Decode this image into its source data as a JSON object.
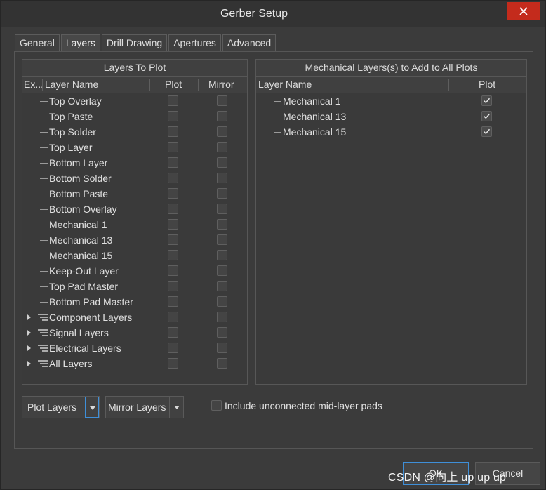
{
  "window": {
    "title": "Gerber Setup"
  },
  "tabs": [
    {
      "label": "General"
    },
    {
      "label": "Layers"
    },
    {
      "label": "Drill Drawing"
    },
    {
      "label": "Apertures"
    },
    {
      "label": "Advanced"
    }
  ],
  "layers_panel": {
    "title": "Layers To Plot",
    "col_expand": "Ex...",
    "col_name": "Layer Name",
    "col_plot": "Plot",
    "col_mirror": "Mirror",
    "rows": [
      {
        "name": "Top Overlay",
        "kind": "layer",
        "plot": false,
        "mirror": false
      },
      {
        "name": "Top Paste",
        "kind": "layer",
        "plot": false,
        "mirror": false
      },
      {
        "name": "Top Solder",
        "kind": "layer",
        "plot": false,
        "mirror": false
      },
      {
        "name": "Top Layer",
        "kind": "layer",
        "plot": false,
        "mirror": false
      },
      {
        "name": "Bottom Layer",
        "kind": "layer",
        "plot": false,
        "mirror": false
      },
      {
        "name": "Bottom Solder",
        "kind": "layer",
        "plot": false,
        "mirror": false
      },
      {
        "name": "Bottom Paste",
        "kind": "layer",
        "plot": false,
        "mirror": false
      },
      {
        "name": "Bottom Overlay",
        "kind": "layer",
        "plot": false,
        "mirror": false
      },
      {
        "name": "Mechanical 1",
        "kind": "layer",
        "plot": false,
        "mirror": false
      },
      {
        "name": "Mechanical 13",
        "kind": "layer",
        "plot": false,
        "mirror": false
      },
      {
        "name": "Mechanical 15",
        "kind": "layer",
        "plot": false,
        "mirror": false
      },
      {
        "name": "Keep-Out Layer",
        "kind": "layer",
        "plot": false,
        "mirror": false
      },
      {
        "name": "Top Pad Master",
        "kind": "layer",
        "plot": false,
        "mirror": false
      },
      {
        "name": "Bottom Pad Master",
        "kind": "layer",
        "plot": false,
        "mirror": false
      },
      {
        "name": "Component Layers",
        "kind": "group",
        "plot": false,
        "mirror": false
      },
      {
        "name": "Signal Layers",
        "kind": "group",
        "plot": false,
        "mirror": false
      },
      {
        "name": "Electrical Layers",
        "kind": "group",
        "plot": false,
        "mirror": false
      },
      {
        "name": "All Layers",
        "kind": "group",
        "plot": false,
        "mirror": false
      }
    ]
  },
  "mech_panel": {
    "title": "Mechanical Layers(s) to Add to All Plots",
    "col_name": "Layer Name",
    "col_plot": "Plot",
    "rows": [
      {
        "name": "Mechanical 1",
        "plot": true
      },
      {
        "name": "Mechanical 13",
        "plot": true
      },
      {
        "name": "Mechanical 15",
        "plot": true
      }
    ]
  },
  "buttons": {
    "plot_layers": "Plot Layers",
    "mirror_layers": "Mirror Layers",
    "ok": "OK",
    "cancel": "Cancel"
  },
  "include_unconnected": {
    "label": "Include unconnected mid-layer pads",
    "checked": false
  },
  "watermark": "CSDN @向上 up up up",
  "icons": {
    "close": "close-icon",
    "expander": "triangle-right-icon",
    "group": "layer-group-icon",
    "check": "checkmark-icon",
    "dropdown": "chevron-down-icon"
  }
}
